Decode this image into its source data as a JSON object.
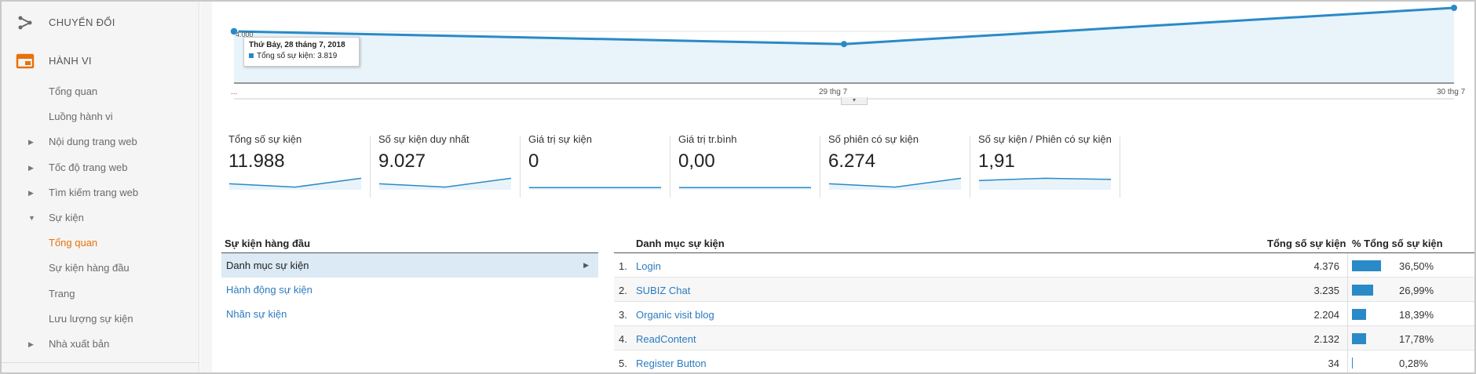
{
  "sidebar": {
    "sections": [
      {
        "label": "CHUYỂN ĐỔI",
        "icon": "conversion-icon"
      },
      {
        "label": "HÀNH VI",
        "icon": "behavior-icon"
      }
    ],
    "items": [
      {
        "label": "Tổng quan",
        "expandable": false,
        "active": false
      },
      {
        "label": "Luồng hành vi",
        "expandable": false,
        "active": false
      },
      {
        "label": "Nội dung trang web",
        "expandable": true,
        "active": false
      },
      {
        "label": "Tốc độ trang web",
        "expandable": true,
        "active": false
      },
      {
        "label": "Tìm kiếm trang web",
        "expandable": true,
        "active": false
      },
      {
        "label": "Sự kiện",
        "expandable": true,
        "expanded": true,
        "active": false
      },
      {
        "label": "Tổng quan",
        "expandable": false,
        "active": true
      },
      {
        "label": "Sự kiện hàng đầu",
        "expandable": false,
        "active": false
      },
      {
        "label": "Trang",
        "expandable": false,
        "active": false
      },
      {
        "label": "Lưu lượng sự kiện",
        "expandable": false,
        "active": false
      },
      {
        "label": "Nhà xuất bản",
        "expandable": true,
        "active": false
      }
    ],
    "triangle_collapsed": "▶",
    "triangle_expanded": "▼"
  },
  "chart_data": {
    "type": "area",
    "x_ticks": [
      "...",
      "29 thg 7",
      "30 thg 7"
    ],
    "y_tick": "4.000",
    "series": [
      {
        "name": "Tổng số sự kiện",
        "values": [
          3819,
          3235,
          4900
        ]
      }
    ],
    "color": "#2a8ac7",
    "fill": "#e8f3fa",
    "tooltip": {
      "date": "Thứ Bảy, 28 tháng 7, 2018",
      "label": "Tổng số sự kiện:",
      "value": "3.819"
    }
  },
  "metrics": [
    {
      "label": "Tổng số sự kiện",
      "value": "11.988",
      "spark": [
        0.4,
        0.1,
        0.9
      ]
    },
    {
      "label": "Số sự kiện duy nhất",
      "value": "9.027",
      "spark": [
        0.4,
        0.1,
        0.9
      ]
    },
    {
      "label": "Giá trị sự kiện",
      "value": "0",
      "spark": [
        0.05,
        0.05,
        0.05
      ]
    },
    {
      "label": "Giá trị tr.bình",
      "value": "0,00",
      "spark": [
        0.05,
        0.05,
        0.05
      ]
    },
    {
      "label": "Số phiên có sự kiện",
      "value": "6.274",
      "spark": [
        0.4,
        0.1,
        0.9
      ]
    },
    {
      "label": "Số sự kiện / Phiên có sự kiện",
      "value": "1,91",
      "spark": [
        0.7,
        0.9,
        0.8
      ]
    }
  ],
  "top_events": {
    "header": "Sự kiện hàng đầu",
    "rows": [
      "Danh mục sự kiện",
      "Hành động sự kiện",
      "Nhãn sự kiện"
    ],
    "arrow": "▶"
  },
  "events_table": {
    "headers": {
      "category": "Danh mục sự kiện",
      "total": "Tổng số sự kiện",
      "pct": "% Tổng số sự kiện"
    },
    "rows": [
      {
        "idx": "1.",
        "name": "Login",
        "total": "4.376",
        "pct": "36,50%",
        "fraction": 0.365
      },
      {
        "idx": "2.",
        "name": "SUBIZ Chat",
        "total": "3.235",
        "pct": "26,99%",
        "fraction": 0.2699
      },
      {
        "idx": "3.",
        "name": "Organic visit blog",
        "total": "2.204",
        "pct": "18,39%",
        "fraction": 0.1839
      },
      {
        "idx": "4.",
        "name": "ReadContent",
        "total": "2.132",
        "pct": "17,78%",
        "fraction": 0.1778
      },
      {
        "idx": "5.",
        "name": "Register Button",
        "total": "34",
        "pct": "0,28%",
        "fraction": 0.0028
      }
    ]
  }
}
